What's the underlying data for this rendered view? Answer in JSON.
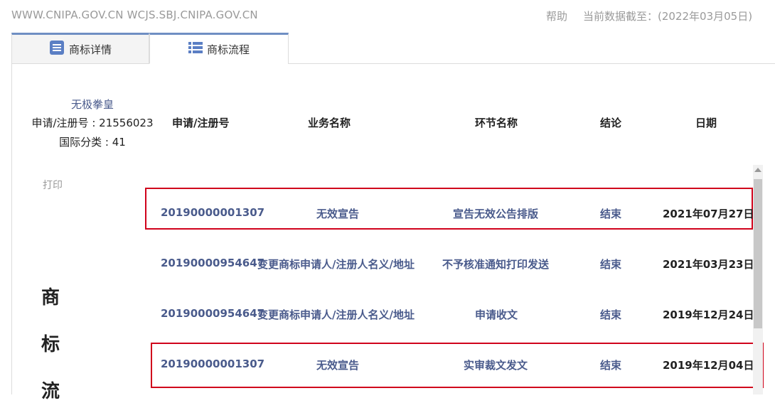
{
  "topbar": {
    "site_url": "WWW.CNIPA.GOV.CN WCJS.SBJ.CNIPA.GOV.CN",
    "help": "帮助",
    "data_date": "当前数据截至：(2022年03月05日)"
  },
  "tabs": [
    {
      "label": "商标详情",
      "icon": "document-list-icon"
    },
    {
      "label": "商标流程",
      "icon": "grid-list-icon"
    }
  ],
  "mark": {
    "name": "无极拳皇",
    "reg_no_text": "申请/注册号 : 21556023",
    "class_text": "国际分类 : 41"
  },
  "table": {
    "headers": [
      "申请/注册号",
      "业务名称",
      "环节名称",
      "结论",
      "日期"
    ],
    "rows": [
      {
        "reg_no": "20190000001307",
        "business": "无效宣告",
        "step": "宣告无效公告排版",
        "result": "结束",
        "date": "2021年07月27日",
        "highlighted": true
      },
      {
        "reg_no": "20190000954647",
        "business": "变更商标申请人/注册人名义/地址",
        "step": "不予核准通知打印发送",
        "result": "结束",
        "date": "2021年03月23日",
        "highlighted": false
      },
      {
        "reg_no": "20190000954647",
        "business": "变更商标申请人/注册人名义/地址",
        "step": "申请收文",
        "result": "结束",
        "date": "2019年12月24日",
        "highlighted": false
      },
      {
        "reg_no": "20190000001307",
        "business": "无效宣告",
        "step": "实审裁文发文",
        "result": "结束",
        "date": "2019年12月04日",
        "highlighted": true
      }
    ]
  },
  "print_label": "打印",
  "vertical_title": [
    "商",
    "标",
    "流"
  ],
  "colors": {
    "link_text": "#4a5b8c",
    "highlight_border": "#d0021b",
    "tab_accent": "#6f8fc3"
  }
}
